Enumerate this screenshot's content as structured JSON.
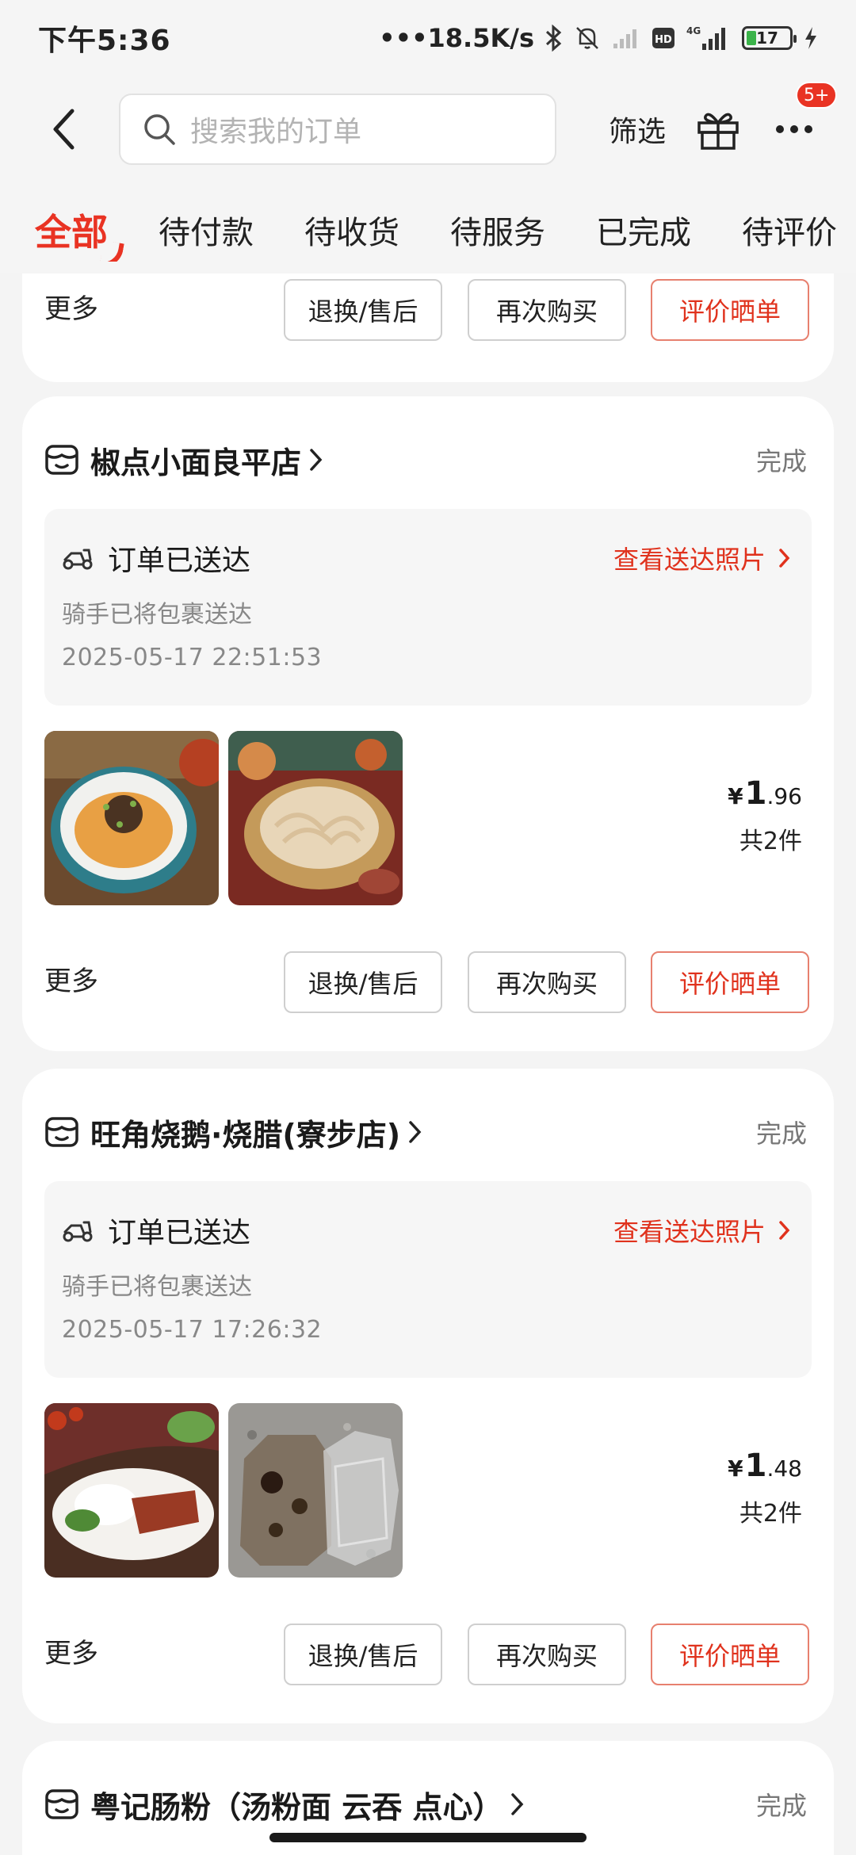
{
  "status_bar": {
    "time": "下午5:36",
    "network_speed": "•••18.5K/s",
    "battery": "17",
    "network_type": "4G"
  },
  "header": {
    "search_placeholder": "搜索我的订单",
    "filter_label": "筛选",
    "notification_badge": "5+"
  },
  "tabs": [
    {
      "label": "全部"
    },
    {
      "label": "待付款"
    },
    {
      "label": "待收货"
    },
    {
      "label": "待服务"
    },
    {
      "label": "已完成"
    },
    {
      "label": "待评价"
    }
  ],
  "actions": {
    "more": "更多",
    "return": "退换/售后",
    "rebuy": "再次购买",
    "review": "评价晒单"
  },
  "orders": [
    {
      "shop": "椒点小面良平店",
      "status": "完成",
      "delivery_title": "订单已送达",
      "delivery_link": "查看送达照片",
      "delivery_sub": "骑手已将包裹送达",
      "delivery_time": "2025-05-17 22:51:53",
      "price_yen": "¥",
      "price_int": "1",
      "price_dec": ".96",
      "count": "共2件"
    },
    {
      "shop": "旺角烧鹅·烧腊(寮步店)",
      "status": "完成",
      "delivery_title": "订单已送达",
      "delivery_link": "查看送达照片",
      "delivery_sub": "骑手已将包裹送达",
      "delivery_time": "2025-05-17 17:26:32",
      "price_yen": "¥",
      "price_int": "1",
      "price_dec": ".48",
      "count": "共2件"
    },
    {
      "shop": "粤记肠粉（汤粉面 云吞 点心）",
      "status": "完成"
    }
  ],
  "colors": {
    "accent": "#e93323",
    "link_red": "#e0321d",
    "background": "#f4f4f4"
  }
}
